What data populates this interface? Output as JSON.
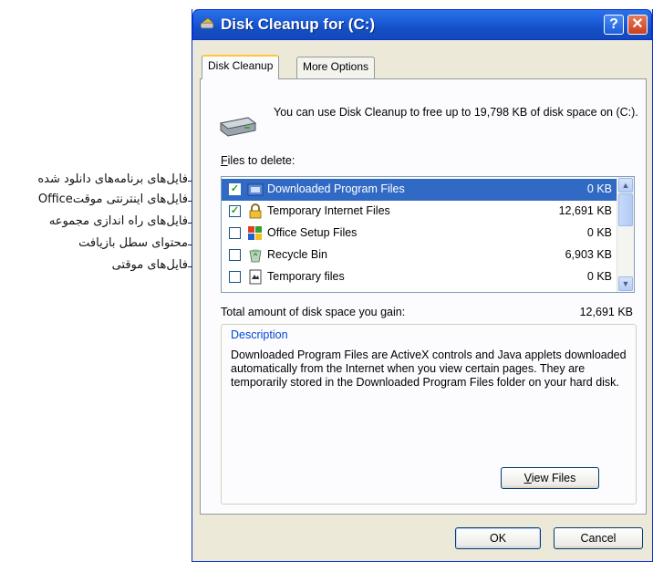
{
  "annotations": [
    "فایل‌های برنامه‌های دانلود شده",
    "فایل‌های اینترنتی موقتOffice",
    "فایل‌های راه اندازی مجموعه",
    "محتوای سطل بازیافت",
    "فایل‌های موقتی"
  ],
  "window": {
    "title": "Disk Cleanup for  (C:)",
    "help_label": "?",
    "close_label": "✕"
  },
  "tabs": [
    {
      "label": "Disk Cleanup",
      "active": true
    },
    {
      "label": "More Options",
      "active": false
    }
  ],
  "intro_text": "You can use Disk Cleanup to free up to 19,798 KB of disk space on  (C:).",
  "files_label_first": "F",
  "files_label_rest": "iles to delete:",
  "files": [
    {
      "name": "Downloaded Program Files",
      "size": "0 KB",
      "checked": true,
      "selected": true,
      "icon": "folder-icon"
    },
    {
      "name": "Temporary Internet Files",
      "size": "12,691 KB",
      "checked": true,
      "selected": false,
      "icon": "lock-icon"
    },
    {
      "name": "Office Setup Files",
      "size": "0 KB",
      "checked": false,
      "selected": false,
      "icon": "office-icon"
    },
    {
      "name": "Recycle Bin",
      "size": "6,903 KB",
      "checked": false,
      "selected": false,
      "icon": "recycle-bin-icon"
    },
    {
      "name": "Temporary files",
      "size": "0 KB",
      "checked": false,
      "selected": false,
      "icon": "document-icon"
    }
  ],
  "total_label": "Total amount of disk space you gain:",
  "total_value": "12,691 KB",
  "description": {
    "title": "Description",
    "text": "Downloaded Program Files are ActiveX controls and Java applets downloaded automatically from the Internet when you view certain pages. They are temporarily stored in the Downloaded Program Files folder on your hard disk."
  },
  "buttons": {
    "view_files_first": "V",
    "view_files_rest": "iew Files",
    "ok": "OK",
    "cancel": "Cancel"
  },
  "colors": {
    "titlebar": "#1a5ad6",
    "selection": "#316ac5",
    "window_bg": "#ece9d8"
  }
}
